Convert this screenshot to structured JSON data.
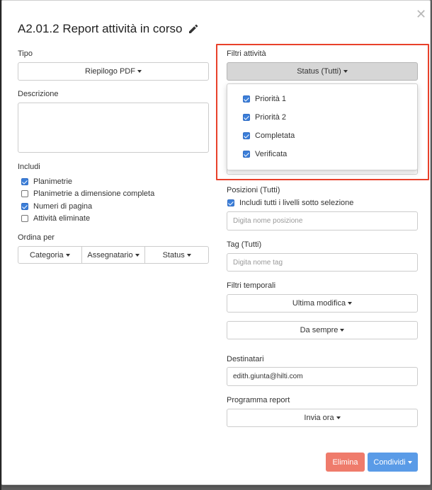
{
  "modal": {
    "title": "A2.01.2 Report attività in corso",
    "close_glyph": "✕"
  },
  "left": {
    "tipo_label": "Tipo",
    "tipo_value": "Riepilogo PDF",
    "descrizione_label": "Descrizione",
    "includi_label": "Includi",
    "includi_items": [
      {
        "label": "Planimetrie",
        "checked": true
      },
      {
        "label": "Planimetrie a dimensione completa",
        "checked": false
      },
      {
        "label": "Numeri di pagina",
        "checked": true
      },
      {
        "label": "Attività eliminate",
        "checked": false
      }
    ],
    "ordina_label": "Ordina per",
    "ordina_options": [
      "Categoria",
      "Assegnatario",
      "Status"
    ]
  },
  "right": {
    "filtri_attivita_label": "Filtri attività",
    "status_button": "Status (Tutti)",
    "status_options": [
      {
        "label": "Priorità 1",
        "checked": true
      },
      {
        "label": "Priorità 2",
        "checked": true
      },
      {
        "label": "Completata",
        "checked": true
      },
      {
        "label": "Verificata",
        "checked": true
      }
    ],
    "posizioni_label": "Posizioni (Tutti)",
    "includi_livelli": "Includi tutti i livelli sotto selezione",
    "posizione_placeholder": "Digita nome posizione",
    "tag_label": "Tag (Tutti)",
    "tag_placeholder": "Digita nome tag",
    "filtri_temporali_label": "Filtri temporali",
    "ultima_modifica": "Ultima modifica",
    "da_sempre": "Da sempre",
    "destinatari_label": "Destinatari",
    "destinatari_value": "edith.giunta@hilti.com",
    "programma_label": "Programma report",
    "invia_ora": "Invia ora"
  },
  "footer": {
    "elimina": "Elimina",
    "condividi": "Condividi"
  },
  "colors": {
    "highlight": "#e8402a",
    "danger": "#ef7b6b",
    "primary": "#5a9be7",
    "checkbox": "#3c7fd9"
  }
}
